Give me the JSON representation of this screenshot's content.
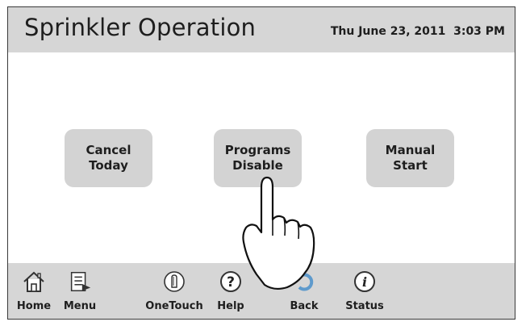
{
  "header": {
    "title": "Sprinkler Operation",
    "datetime": "Thu June 23, 2011  3:03 PM"
  },
  "buttons": [
    {
      "line1": "Cancel",
      "line2": "Today"
    },
    {
      "line1": "Programs",
      "line2": "Disable"
    },
    {
      "line1": "Manual",
      "line2": "Start"
    }
  ],
  "toolbar": {
    "items": [
      {
        "label": "Home",
        "icon": "house-icon"
      },
      {
        "label": "Menu",
        "icon": "menu-icon"
      },
      {
        "label": "OneTouch",
        "icon": "onetouch-icon"
      },
      {
        "label": "Help",
        "icon": "help-icon"
      },
      {
        "label": "Back",
        "icon": "back-arrow-icon"
      },
      {
        "label": "Status",
        "icon": "info-icon"
      }
    ]
  },
  "colors": {
    "header_bg": "#d6d6d6",
    "button_bg": "#d3d3d3",
    "text": "#1e1e1e"
  }
}
